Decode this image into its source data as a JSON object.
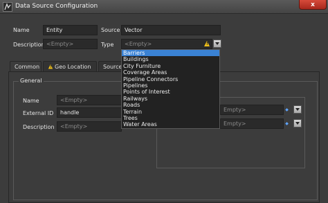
{
  "window": {
    "title": "Data Source Configuration",
    "close_glyph": "x"
  },
  "top_form": {
    "name_label": "Name",
    "name_value": "Entity",
    "source_label": "Source",
    "source_value": "Vector",
    "description_label": "Description",
    "description_placeholder": "<Empty>",
    "type_label": "Type",
    "type_value": "<Empty>"
  },
  "tabs": [
    {
      "label": "Common"
    },
    {
      "label": "Geo Location"
    },
    {
      "label": "Source"
    }
  ],
  "general": {
    "group_title": "General",
    "name_label": "Name",
    "name_placeholder": "<Empty>",
    "external_id_label": "External ID",
    "external_id_value": "handle",
    "description_label": "Description",
    "description_placeholder": "<Empty>"
  },
  "right_group": {
    "field1_value": "Empty>",
    "field2_value": "Empty>"
  },
  "type_dropdown": {
    "selected_index": 0,
    "items": [
      "Barriers",
      "Buildings",
      "City Furniture",
      "Coverage Areas",
      "Pipeline Connectors",
      "Pipelines",
      "Points of Interest",
      "Railways",
      "Roads",
      "Terrain",
      "Trees",
      "Water Areas"
    ]
  },
  "colors": {
    "selection": "#3a82d4",
    "warning": "#f2c21a",
    "close": "#c8392b"
  }
}
